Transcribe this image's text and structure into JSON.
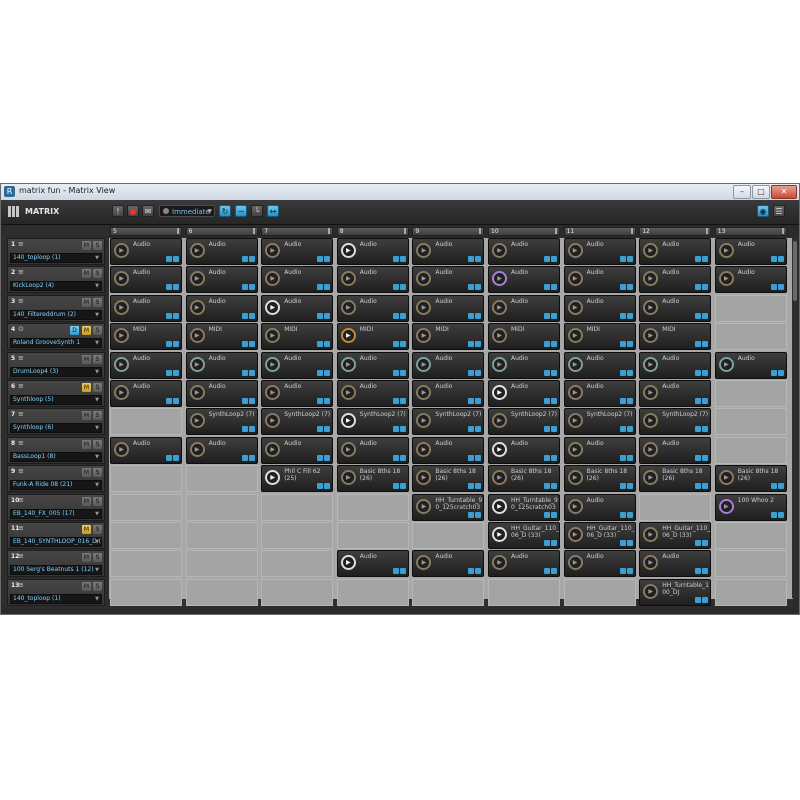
{
  "window": {
    "title": "matrix fun - Matrix View",
    "app_icon": "R"
  },
  "toolbar": {
    "title": "MATRIX",
    "quantize": "Immediate"
  },
  "columns": [
    "5",
    "6",
    "7",
    "8",
    "9",
    "10",
    "11",
    "12",
    "13"
  ],
  "tracks": [
    {
      "num": "1",
      "name": "140_toploop (1)",
      "icon": "sliders-icon",
      "m_on": false,
      "dsn": false
    },
    {
      "num": "2",
      "name": "KickLoop2 (4)",
      "icon": "sliders-icon",
      "m_on": false,
      "dsn": false
    },
    {
      "num": "3",
      "name": "140_Filtereddrum (2)",
      "icon": "sliders-icon",
      "m_on": false,
      "dsn": false
    },
    {
      "num": "4",
      "name": "Roland GrooveSynth 1",
      "icon": "midi-icon",
      "m_on": true,
      "dsn": true
    },
    {
      "num": "5",
      "name": "DrumLoop4 (3)",
      "icon": "sliders-icon",
      "m_on": false,
      "dsn": false
    },
    {
      "num": "6",
      "name": "Synthloop (5)",
      "icon": "sliders-icon",
      "m_on": true,
      "dsn": false
    },
    {
      "num": "7",
      "name": "Synthloop (6)",
      "icon": "sliders-icon",
      "m_on": false,
      "dsn": false
    },
    {
      "num": "8",
      "name": "BassLoop1 (8)",
      "icon": "sliders-icon",
      "m_on": false,
      "dsn": false
    },
    {
      "num": "9",
      "name": "Funk-A Ride 08 (21)",
      "icon": "sliders-icon",
      "m_on": false,
      "dsn": false
    },
    {
      "num": "10",
      "name": "EB_140_FX_005 (17)",
      "icon": "sliders-icon",
      "m_on": false,
      "dsn": false
    },
    {
      "num": "11",
      "name": "EB_140_SYNTHLOOP_016_D (31)",
      "icon": "sliders-icon",
      "m_on": true,
      "dsn": false
    },
    {
      "num": "12",
      "name": "100 Serg's Beatnuts 1 (12)",
      "icon": "sliders-icon",
      "m_on": false,
      "dsn": false
    },
    {
      "num": "13",
      "name": "140_toploop (1)",
      "icon": "sliders-icon",
      "m_on": false,
      "dsn": false
    }
  ],
  "grid": [
    [
      {
        "t": "Audio",
        "s": "ar"
      },
      {
        "t": "Audio",
        "s": "ar"
      },
      {
        "t": "Audio",
        "s": "ar"
      },
      {
        "t": "Audio",
        "s": "wh"
      },
      {
        "t": "Audio",
        "s": "ar"
      },
      {
        "t": "Audio",
        "s": "ar"
      },
      {
        "t": "Audio",
        "s": "ar"
      },
      {
        "t": "Audio",
        "s": "ar"
      },
      {
        "t": "Audio",
        "s": "ar"
      }
    ],
    [
      {
        "t": "Audio",
        "s": "ar"
      },
      {
        "t": "Audio",
        "s": "ar"
      },
      {
        "t": "Audio",
        "s": "ar"
      },
      {
        "t": "Audio",
        "s": "ar"
      },
      {
        "t": "Audio",
        "s": "ar"
      },
      {
        "t": "Audio",
        "s": "pu"
      },
      {
        "t": "Audio",
        "s": "ar"
      },
      {
        "t": "Audio",
        "s": "ar"
      },
      {
        "t": "Audio",
        "s": "ar"
      }
    ],
    [
      {
        "t": "Audio",
        "s": "ar"
      },
      {
        "t": "Audio",
        "s": "ar"
      },
      {
        "t": "Audio",
        "s": "wh"
      },
      {
        "t": "Audio",
        "s": "ar"
      },
      {
        "t": "Audio",
        "s": "ar"
      },
      {
        "t": "Audio",
        "s": "ar"
      },
      {
        "t": "Audio",
        "s": "ar"
      },
      {
        "t": "Audio",
        "s": "ar"
      },
      null
    ],
    [
      {
        "t": "MIDI",
        "s": "ar"
      },
      {
        "t": "MIDI",
        "s": "ar"
      },
      {
        "t": "MIDI",
        "s": "ar"
      },
      {
        "t": "MIDI",
        "s": "pl"
      },
      {
        "t": "MIDI",
        "s": "ar"
      },
      {
        "t": "MIDI",
        "s": "ar"
      },
      {
        "t": "MIDI",
        "s": "ar"
      },
      {
        "t": "MIDI",
        "s": "ar"
      },
      null
    ],
    [
      {
        "t": "Audio",
        "s": "gr"
      },
      {
        "t": "Audio",
        "s": "gr"
      },
      {
        "t": "Audio",
        "s": "gr"
      },
      {
        "t": "Audio",
        "s": "gr"
      },
      {
        "t": "Audio",
        "s": "gr"
      },
      {
        "t": "Audio",
        "s": "gr"
      },
      {
        "t": "Audio",
        "s": "gr"
      },
      {
        "t": "Audio",
        "s": "gr"
      },
      {
        "t": "Audio",
        "s": "gr"
      }
    ],
    [
      {
        "t": "Audio",
        "s": "ar"
      },
      {
        "t": "Audio",
        "s": "ar"
      },
      {
        "t": "Audio",
        "s": "ar"
      },
      {
        "t": "Audio",
        "s": "ar"
      },
      {
        "t": "Audio",
        "s": "ar"
      },
      {
        "t": "Audio",
        "s": "wh"
      },
      {
        "t": "Audio",
        "s": "ar"
      },
      {
        "t": "Audio",
        "s": "ar"
      },
      null
    ],
    [
      null,
      {
        "t": "SynthLoop2 (7)",
        "s": "ar"
      },
      {
        "t": "SynthLoop2 (7)",
        "s": "ar"
      },
      {
        "t": "SynthLoop2 (7)",
        "s": "wh"
      },
      {
        "t": "SynthLoop2 (7)",
        "s": "ar"
      },
      {
        "t": "SynthLoop2 (7)",
        "s": "ar"
      },
      {
        "t": "SynthLoop2 (7)",
        "s": "ar"
      },
      {
        "t": "SynthLoop2 (7)",
        "s": "ar"
      },
      null
    ],
    [
      {
        "t": "Audio",
        "s": "ar"
      },
      {
        "t": "Audio",
        "s": "ar"
      },
      {
        "t": "Audio",
        "s": "ar"
      },
      {
        "t": "Audio",
        "s": "ar"
      },
      {
        "t": "Audio",
        "s": "ar"
      },
      {
        "t": "Audio",
        "s": "wh"
      },
      {
        "t": "Audio",
        "s": "ar"
      },
      {
        "t": "Audio",
        "s": "ar"
      },
      null
    ],
    [
      null,
      null,
      {
        "t": "Phil C Fill 62 (25)",
        "s": "wh"
      },
      {
        "t": "Basic 8ths 18 (26)",
        "s": "ar"
      },
      {
        "t": "Basic 8ths 18 (26)",
        "s": "ar"
      },
      {
        "t": "Basic 8ths 18 (26)",
        "s": "ar"
      },
      {
        "t": "Basic 8ths 18 (26)",
        "s": "ar"
      },
      {
        "t": "Basic 8ths 18 (26)",
        "s": "ar"
      },
      {
        "t": "Basic 8ths 18 (26)",
        "s": "ar"
      }
    ],
    [
      null,
      null,
      null,
      null,
      {
        "t": "HH_Turntable_9 0_125cratch03",
        "s": "ar"
      },
      {
        "t": "HH_Turntable_9 0_125cratch03",
        "s": "wh"
      },
      {
        "t": "Audio",
        "s": "ar"
      },
      null,
      {
        "t": "100 Whoo 2",
        "s": "pu"
      }
    ],
    [
      null,
      null,
      null,
      null,
      null,
      {
        "t": "HH_Guitar_110_ 06_D (33)",
        "s": "wh"
      },
      {
        "t": "HH_Guitar_110_ 06_D (33)",
        "s": "ar"
      },
      {
        "t": "HH_Guitar_110_ 06_D (33)",
        "s": "ar"
      },
      null
    ],
    [
      null,
      null,
      null,
      {
        "t": "Audio",
        "s": "wh"
      },
      {
        "t": "Audio",
        "s": "ar"
      },
      {
        "t": "Audio",
        "s": "ar"
      },
      {
        "t": "Audio",
        "s": "ar"
      },
      {
        "t": "Audio",
        "s": "ar"
      },
      null
    ],
    [
      null,
      null,
      null,
      null,
      null,
      null,
      null,
      {
        "t": "HH_Turntable_1 00_DJ",
        "s": "ar"
      },
      null
    ]
  ],
  "icons": {
    "play": "play-icon",
    "sliders": "sliders-icon",
    "midi": "midi-icon",
    "record": "record-icon",
    "loop": "loop-icon",
    "grid": "grid-view-icon"
  },
  "colors": {
    "accent": "#3a9fd6",
    "mute_on": "#e0b23a",
    "clip_bg": "#262626",
    "empty_cell": "#a4a4a4"
  }
}
